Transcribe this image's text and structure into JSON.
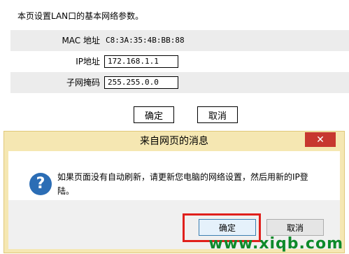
{
  "page": {
    "intro": "本页设置LAN口的基本网络参数。",
    "mac": {
      "label": "MAC 地址",
      "value": "C8:3A:35:4B:BB:88"
    },
    "ip": {
      "label": "IP地址",
      "value": "172.168.1.1"
    },
    "mask": {
      "label": "子网掩码",
      "value": "255.255.0.0"
    },
    "ok_label": "确定",
    "cancel_label": "取消"
  },
  "dialog": {
    "title": "来自网页的消息",
    "close_glyph": "✕",
    "icon_glyph": "?",
    "message": "如果页面没有自动刷新，请更新您电脑的网络设置，然后用新的IP登陆。",
    "ok_label": "确定",
    "cancel_label": "取消"
  },
  "watermark": "www.xiqb.com",
  "colors": {
    "dialog_frame": "#f5e7b2",
    "close_button": "#c7372f",
    "question_icon": "#2b6db5",
    "highlight": "#e0201c",
    "watermark": "#0d8a2a"
  }
}
